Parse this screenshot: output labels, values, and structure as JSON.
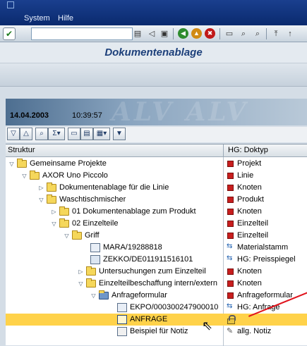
{
  "menubar": {
    "items": [
      "System",
      "Hilfe"
    ]
  },
  "toolbar": {
    "command_value": ""
  },
  "title": "Dokumentenablage",
  "alv_header": {
    "date": "14.04.2003",
    "time": "10:39:57",
    "watermark": "ALV ALV"
  },
  "tree": {
    "columns": [
      "Struktur",
      "HG: Doktyp"
    ],
    "rows": [
      {
        "label": "Gemeinsame Projekte",
        "type": "Projekt"
      },
      {
        "label": "AXOR Uno Piccolo",
        "type": "Linie"
      },
      {
        "label": "Dokumentenablage für die Linie",
        "type": "Knoten"
      },
      {
        "label": "Waschtischmischer",
        "type": "Produkt"
      },
      {
        "label": "01 Dokumentenablage zum Produkt",
        "type": "Knoten"
      },
      {
        "label": "02 Einzelteile",
        "type": "Einzelteil"
      },
      {
        "label": "Griff",
        "type": "Einzelteil"
      },
      {
        "label": "MARA/19288818",
        "type": "Materialstamm"
      },
      {
        "label": "ZEKKO/DE011911516101",
        "type": "HG: Preisspiegel"
      },
      {
        "label": "Untersuchungen zum Einzelteil",
        "type": "Knoten"
      },
      {
        "label": "Einzelteilbeschaffung intern/extern",
        "type": "Knoten"
      },
      {
        "label": "Anfrageformular",
        "type": "Anfrageformular"
      },
      {
        "label": "EKPO/000300247900010",
        "type": "HG: Anfrage"
      },
      {
        "label": "ANFRAGE",
        "type": ""
      },
      {
        "label": "Beispiel für Notiz",
        "type": "allg. Notiz"
      }
    ]
  },
  "colors": {
    "selection": "#ffd24a",
    "title": "#1c3f7a",
    "menubar": "#0a2a6e"
  }
}
